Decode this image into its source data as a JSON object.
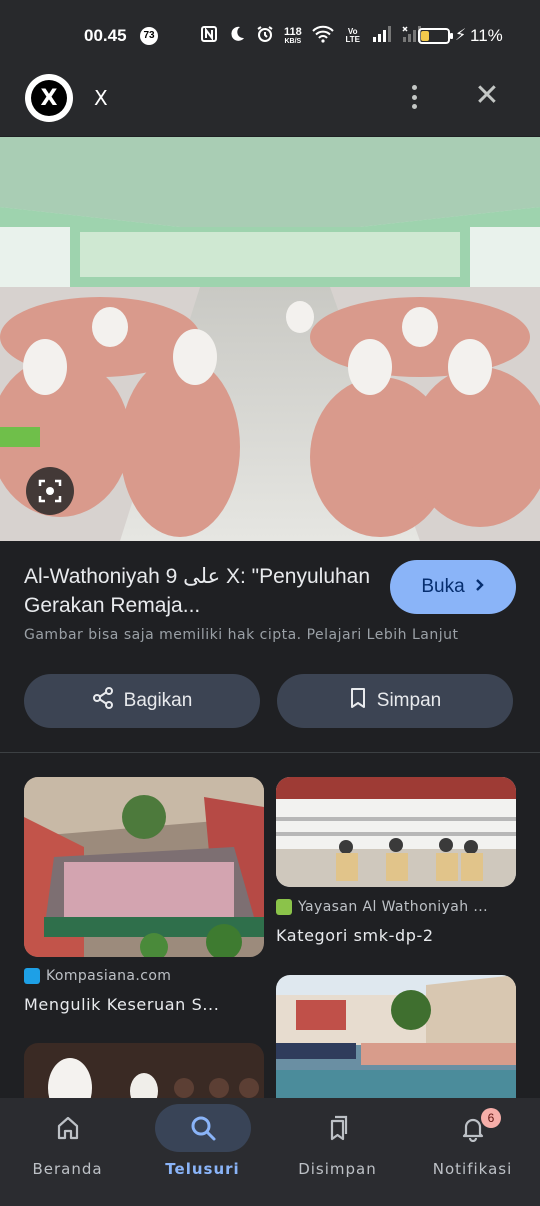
{
  "status_bar": {
    "time": "00.45",
    "notification_count": "73",
    "net_speed_value": "118",
    "net_speed_unit": "KB/S",
    "volte": "Vo LTE",
    "battery_percent": "11%",
    "battery_level": 0.11
  },
  "app_bar": {
    "logo_letter": "X",
    "title": "X"
  },
  "result": {
    "title": "Al-Wathoniyah 9 على X: \"Penyuluhan Gerakan Remaja...",
    "open_label": "Buka",
    "copyright": "Gambar bisa saja memiliki hak cipta. Pelajari Lebih Lanjut",
    "share_label": "Bagikan",
    "save_label": "Simpan"
  },
  "related": [
    {
      "source": "Kompasiana.com",
      "caption": "Mengulik Keseruan S..."
    },
    {
      "source": "Yayasan Al Wathoniyah ...",
      "caption": "Kategori smk-dp-2"
    },
    {
      "source": "",
      "caption": ""
    },
    {
      "source": "",
      "caption": ""
    }
  ],
  "bottom_nav": [
    {
      "label": "Beranda",
      "icon": "home-icon",
      "active": false
    },
    {
      "label": "Telusuri",
      "icon": "search-icon",
      "active": true
    },
    {
      "label": "Disimpan",
      "icon": "bookmarks-icon",
      "active": false
    },
    {
      "label": "Notifikasi",
      "icon": "bell-icon",
      "active": false,
      "badge": "6"
    }
  ],
  "colors": {
    "background": "#1f2023",
    "accent": "#8ab4f8",
    "pill": "#3c4453"
  }
}
